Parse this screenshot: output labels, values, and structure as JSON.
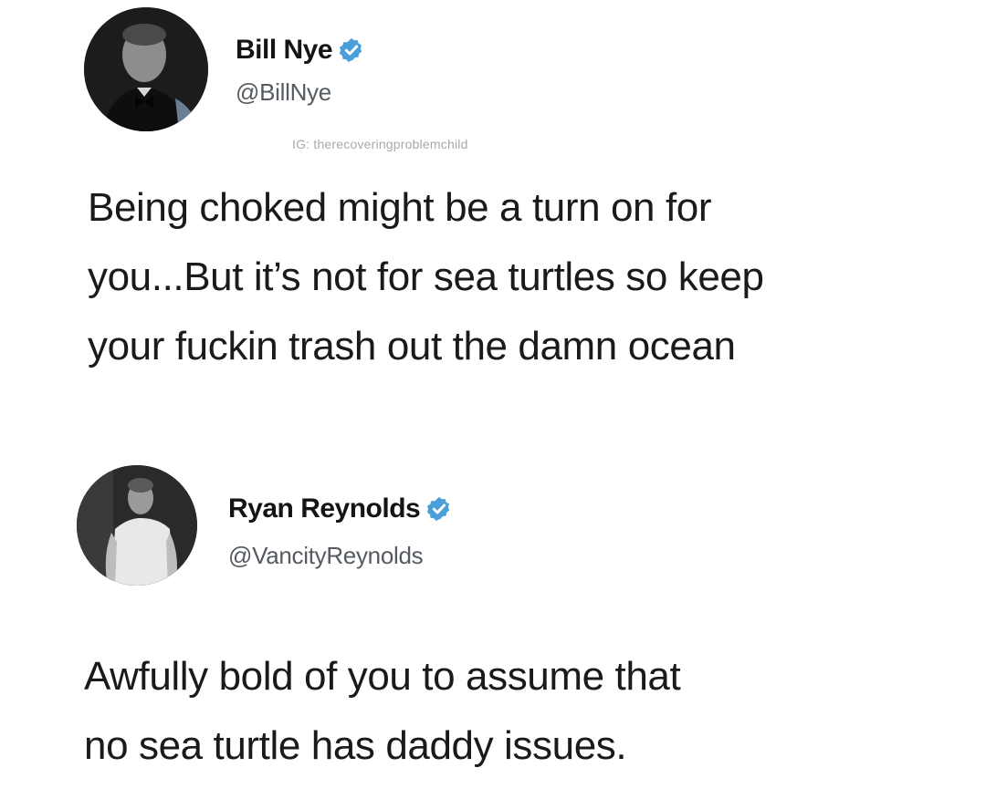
{
  "tweets": [
    {
      "display_name": "Bill Nye",
      "handle": "@BillNye",
      "verified": true,
      "watermark": "IG: therecoveringproblemchild",
      "text": "Being choked might be a turn on for\nyou...But it’s not for sea turtles so keep\nyour fuckin trash out the damn ocean",
      "avatar_icon": "avatar-bill-nye-photo"
    },
    {
      "display_name": "Ryan Reynolds",
      "handle": "@VancityReynolds",
      "verified": true,
      "text": "Awfully bold of you to assume that\nno sea turtle has daddy issues.",
      "avatar_icon": "avatar-ryan-reynolds-photo"
    }
  ],
  "colors": {
    "background": "#ffffff",
    "text": "#1a1a1a",
    "handle": "#555b60",
    "verified_badge": "#4a9fd8",
    "watermark": "#a9a9a9"
  }
}
